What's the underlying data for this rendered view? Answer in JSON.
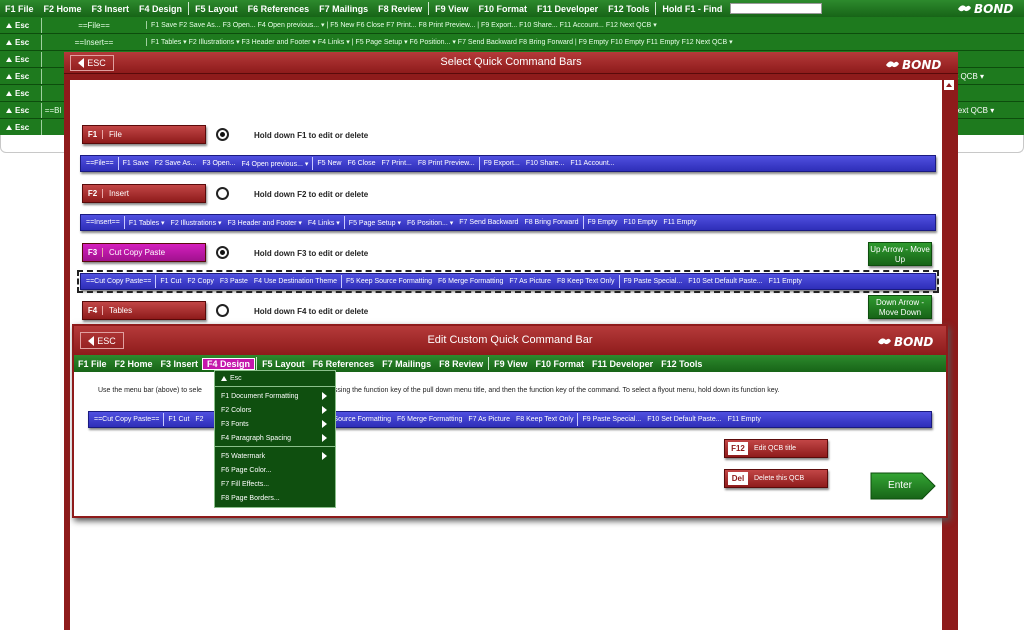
{
  "app": {
    "brand": "BOND",
    "find_placeholder": ""
  },
  "colors": {
    "green": "#1e7a1e",
    "red": "#8e1b1b",
    "blue": "#3a3ad0",
    "pink": "#c418ac"
  },
  "top_menu": [
    "F1 File",
    "F2 Home",
    "F3 Insert",
    "F4 Design",
    "F5 Layout",
    "F6 References",
    "F7 Mailings",
    "F8 Review",
    "F9 View",
    "F10 Format",
    "F11 Developer",
    "F12 Tools",
    "Hold F1 - Find"
  ],
  "bg_rows": [
    {
      "esc": "Esc",
      "label": "==File==",
      "items": "F1 Save   F2 Save As...   F3 Open...   F4 Open previous... ▾ | F5 New   F6 Close   F7 Print...   F8 Print Preview... | F9 Export...   F10 Share...   F11 Account...   F12 Next QCB ▾"
    },
    {
      "esc": "Esc",
      "label": "==Insert==",
      "items": "F1 Tables ▾   F2 Illustrations ▾   F3 Header and Footer ▾   F4 Links ▾ | F5 Page Setup ▾   F6 Position... ▾   F7 Send Backward   F8 Bring Forward | F9 Empty   F10 Empty   F11 Empty   F12 Next QCB ▾"
    },
    {
      "esc": "Esc",
      "label": "",
      "items": ""
    },
    {
      "esc": "Esc",
      "label": "",
      "items": ""
    },
    {
      "esc": "Esc",
      "label": "",
      "items": ""
    },
    {
      "esc": "Esc",
      "label": "==Bl",
      "items": ""
    },
    {
      "esc": "Esc",
      "label": "",
      "items": ""
    }
  ],
  "bg_right": [
    "xt QCB ▾",
    "",
    "▾",
    "Next QCB ▾"
  ],
  "select_dialog": {
    "esc": "ESC",
    "title": "Select Quick Command Bars",
    "groups": [
      {
        "key": "F1",
        "name": "File",
        "hint": "Hold down F1 to edit or delete",
        "qcb_label": "==File==",
        "qcb_items": [
          [
            "F1 Save",
            "F2 Save As...",
            "F3 Open...",
            "F4 Open previous... ▾"
          ],
          [
            "F5 New",
            "F6 Close",
            "F7 Print...",
            "F8 Print Preview..."
          ],
          [
            "F9 Export...",
            "F10 Share...",
            "F11 Account..."
          ]
        ]
      },
      {
        "key": "F2",
        "name": "Insert",
        "hint": "Hold down F2 to edit or delete",
        "qcb_label": "==Insert==",
        "qcb_items": [
          [
            "F1 Tables ▾",
            "F2 Illustrations ▾",
            "F3 Header and Footer ▾",
            "F4 Links ▾"
          ],
          [
            "F5 Page Setup ▾",
            "F6 Position... ▾",
            "F7 Send Backward",
            "F8 Bring Forward"
          ],
          [
            "F9 Empty",
            "F10 Empty",
            "F11 Empty"
          ]
        ]
      },
      {
        "key": "F3",
        "name": "Cut Copy Paste",
        "hint": "Hold down F3 to edit or delete",
        "qcb_label": "==Cut Copy Paste==",
        "qcb_items": [
          [
            "F1 Cut",
            "F2 Copy",
            "F3 Paste",
            "F4 Use Destination Theme"
          ],
          [
            "F5 Keep Source Formatting",
            "F6 Merge Formatting",
            "F7 As Picture",
            "F8 Keep Text Only"
          ],
          [
            "F9 Paste Special...",
            "F10 Set Default Paste...",
            "F11 Empty"
          ]
        ]
      },
      {
        "key": "F4",
        "name": "Tables",
        "hint": "Hold down F4 to edit or delete"
      }
    ],
    "up_button": "Up Arrow - Move Up",
    "down_button": "Down Arrow - Move Down"
  },
  "edit_dialog": {
    "esc": "ESC",
    "title": "Edit Custom Quick Command Bar",
    "menu": [
      "F1 File",
      "F2 Home",
      "F3 Insert",
      "F4 Design",
      "F5 Layout",
      "F6 References",
      "F7 Mailings",
      "F8 Review",
      "F9 View",
      "F10 Format",
      "F11 Developer",
      "F12 Tools"
    ],
    "instruction_left": "Use the menu bar (above) to sele",
    "instruction_right": "ssing the function key of the pull down menu title, and then the function key of the command. To select a flyout menu, hold down its function key.",
    "qcb_label": "==Cut Copy Paste==",
    "qcb_visible_left": [
      "F1 Cut",
      "F2"
    ],
    "qcb_visible_right": [
      "p Source Formatting",
      "F6 Merge Formatting",
      "F7 As Picture",
      "F8 Keep Text Only",
      "|",
      "F9 Paste Special...",
      "F10 Set Default Paste...",
      "F11 Empty"
    ],
    "btn_f12_key": "F12",
    "btn_f12_label": "Edit QCB title",
    "btn_del_key": "Del",
    "btn_del_label": "Delete this QCB",
    "enter": "Enter"
  },
  "design_dropdown": {
    "esc": "Esc",
    "items": [
      {
        "label": "F1 Document Formatting",
        "flyout": true
      },
      {
        "label": "F2 Colors",
        "flyout": true
      },
      {
        "label": "F3 Fonts",
        "flyout": true
      },
      {
        "label": "F4 Paragraph Spacing",
        "flyout": true
      },
      {
        "label": "F5 Watermark",
        "flyout": true
      },
      {
        "label": "F6 Page Color...",
        "flyout": false
      },
      {
        "label": "F7 Fill Effects...",
        "flyout": false
      },
      {
        "label": "F8 Page Borders...",
        "flyout": false
      }
    ]
  }
}
